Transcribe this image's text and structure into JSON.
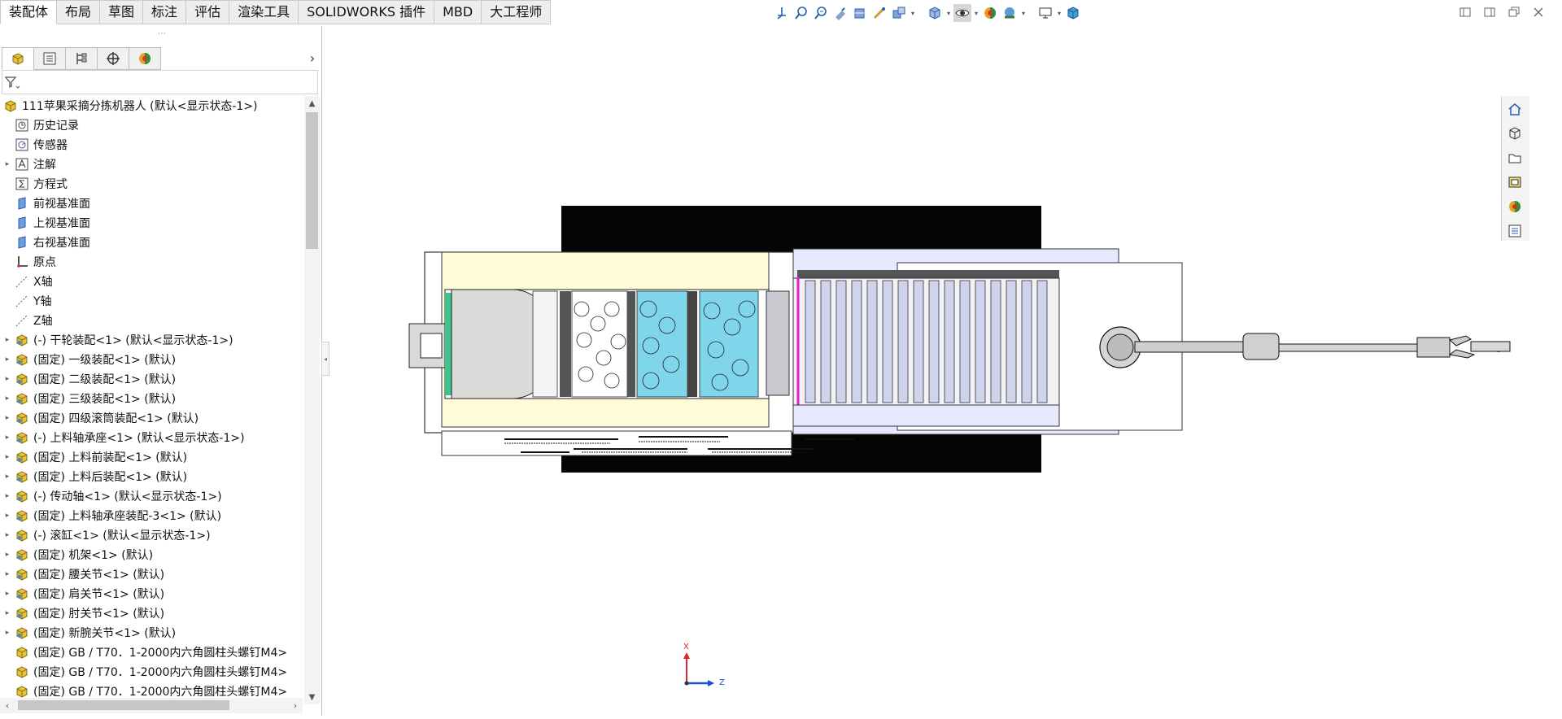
{
  "tabs": [
    "装配体",
    "布局",
    "草图",
    "标注",
    "评估",
    "渲染工具",
    "SOLIDWORKS 插件",
    "MBD",
    "大工程师"
  ],
  "active_tab_index": 0,
  "tree": {
    "root": "111苹果采摘分拣机器人 (默认<显示状态-1>)",
    "items": [
      {
        "label": "历史记录",
        "icon": "history-icon",
        "expandable": false
      },
      {
        "label": "传感器",
        "icon": "sensor-icon",
        "expandable": false
      },
      {
        "label": "注解",
        "icon": "annotation-icon",
        "expandable": true
      },
      {
        "label": "方程式",
        "icon": "equation-icon",
        "expandable": false
      },
      {
        "label": "前视基准面",
        "icon": "plane-icon",
        "expandable": false
      },
      {
        "label": "上视基准面",
        "icon": "plane-icon",
        "expandable": false
      },
      {
        "label": "右视基准面",
        "icon": "plane-icon",
        "expandable": false
      },
      {
        "label": "原点",
        "icon": "origin-icon",
        "expandable": false
      },
      {
        "label": "X轴",
        "icon": "axis-icon",
        "expandable": false
      },
      {
        "label": "Y轴",
        "icon": "axis-icon",
        "expandable": false
      },
      {
        "label": "Z轴",
        "icon": "axis-icon",
        "expandable": false
      },
      {
        "label": "(-) 干轮装配<1> (默认<显示状态-1>)",
        "icon": "subassembly-icon",
        "expandable": true
      },
      {
        "label": "(固定) 一级装配<1> (默认)",
        "icon": "subassembly-icon",
        "expandable": true
      },
      {
        "label": "(固定) 二级装配<1> (默认)",
        "icon": "subassembly-icon",
        "expandable": true
      },
      {
        "label": "(固定) 三级装配<1> (默认)",
        "icon": "subassembly-icon",
        "expandable": true
      },
      {
        "label": "(固定) 四级滚筒装配<1> (默认)",
        "icon": "subassembly-icon",
        "expandable": true
      },
      {
        "label": "(-) 上料轴承座<1> (默认<显示状态-1>)",
        "icon": "subassembly-icon",
        "expandable": true
      },
      {
        "label": "(固定) 上料前装配<1> (默认)",
        "icon": "subassembly-icon",
        "expandable": true
      },
      {
        "label": "(固定) 上料后装配<1> (默认)",
        "icon": "subassembly-icon",
        "expandable": true
      },
      {
        "label": "(-) 传动轴<1> (默认<显示状态-1>)",
        "icon": "subassembly-icon",
        "expandable": true
      },
      {
        "label": "(固定) 上料轴承座装配-3<1> (默认)",
        "icon": "subassembly-icon",
        "expandable": true
      },
      {
        "label": "(-) 滚缸<1> (默认<显示状态-1>)",
        "icon": "subassembly-icon",
        "expandable": true
      },
      {
        "label": "(固定) 机架<1> (默认)",
        "icon": "subassembly-icon",
        "expandable": true
      },
      {
        "label": "(固定) 腰关节<1> (默认)",
        "icon": "subassembly-icon",
        "expandable": true
      },
      {
        "label": "(固定) 肩关节<1> (默认)",
        "icon": "subassembly-icon",
        "expandable": true
      },
      {
        "label": "(固定) 肘关节<1> (默认)",
        "icon": "subassembly-icon",
        "expandable": true
      },
      {
        "label": "(固定) 新腕关节<1> (默认)",
        "icon": "subassembly-icon",
        "expandable": true
      },
      {
        "label": "(固定) GB / T70．1-2000内六角圆柱头螺钉M4>",
        "icon": "part-icon",
        "expandable": false
      },
      {
        "label": "(固定) GB / T70．1-2000内六角圆柱头螺钉M4>",
        "icon": "part-icon",
        "expandable": false
      },
      {
        "label": "(固定) GB / T70．1-2000内六角圆柱头螺钉M4>",
        "icon": "part-icon",
        "expandable": false
      }
    ]
  },
  "triad": {
    "x_label": "X",
    "z_label": "Z"
  },
  "colors": {
    "accent_blue": "#1f6fc4",
    "part_yellow": "#e7c33a",
    "triad_red": "#e0262a",
    "triad_blue": "#1a4fd8"
  }
}
